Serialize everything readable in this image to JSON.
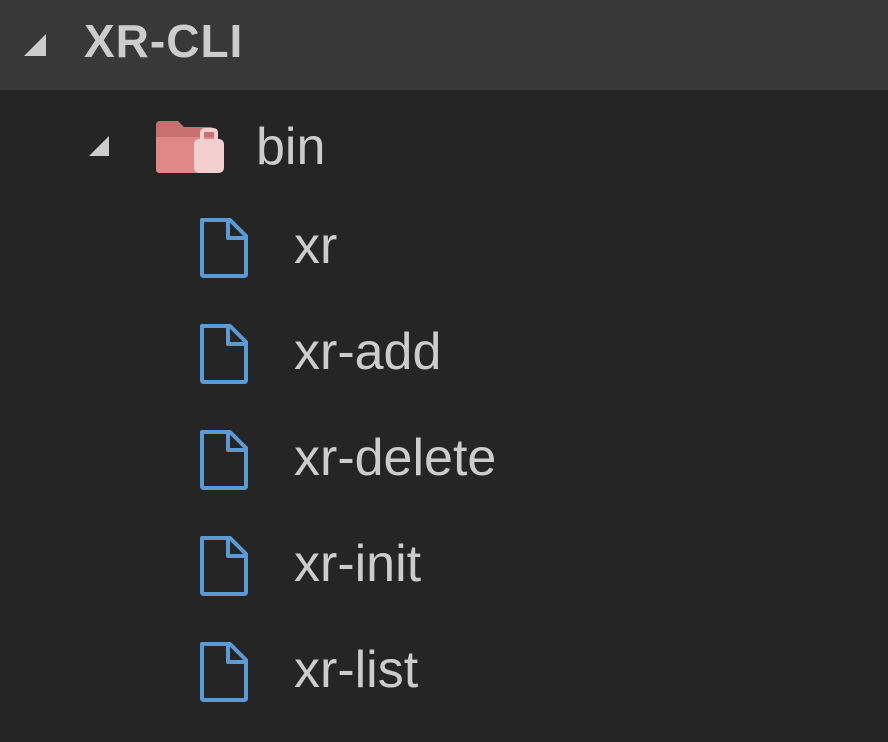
{
  "explorer": {
    "section_title": "XR-CLI",
    "folder": {
      "label": "bin",
      "icon": "folder-open-icon",
      "color": "#d57a7a"
    },
    "files": [
      {
        "label": "xr",
        "icon": "file-icon"
      },
      {
        "label": "xr-add",
        "icon": "file-icon"
      },
      {
        "label": "xr-delete",
        "icon": "file-icon"
      },
      {
        "label": "xr-init",
        "icon": "file-icon"
      },
      {
        "label": "xr-list",
        "icon": "file-icon"
      }
    ]
  },
  "colors": {
    "background": "#252526",
    "header_background": "#383838",
    "text": "#cccccc",
    "file_icon": "#5b9bd5",
    "folder_icon": "#d57a7a"
  }
}
